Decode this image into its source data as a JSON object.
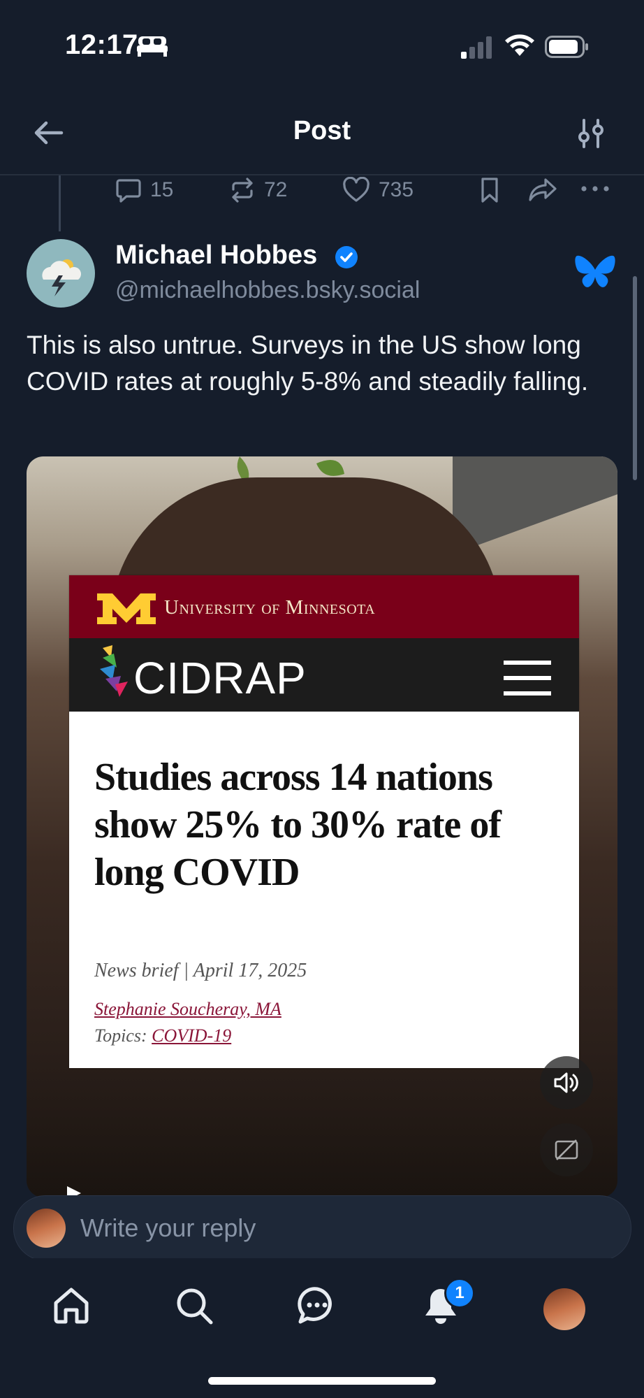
{
  "status_bar": {
    "time": "12:17"
  },
  "header": {
    "title": "Post"
  },
  "previous_post": {
    "replies": "15",
    "reposts": "72",
    "likes": "735"
  },
  "post": {
    "author_name": "Michael Hobbes",
    "author_handle": "@michaelhobbes.bsky.social",
    "text": "This is also untrue. Surveys in the US show long COVID rates at roughly 5-8% and steadily falling."
  },
  "media": {
    "university": "University of Minnesota",
    "site": "CIDRAP",
    "headline": "Studies across 14 nations show 25% to 30% rate of long COVID",
    "meta": "News brief  |  April 17, 2025",
    "author": "Stephanie Soucheray, MA",
    "topics_label": "Topics:",
    "topic": "COVID-19"
  },
  "reply": {
    "placeholder": "Write your reply"
  },
  "tabbar": {
    "notifications_badge": "1"
  },
  "colors": {
    "background": "#151d2b",
    "accent": "#1083fe",
    "muted": "#7f8b9d"
  }
}
